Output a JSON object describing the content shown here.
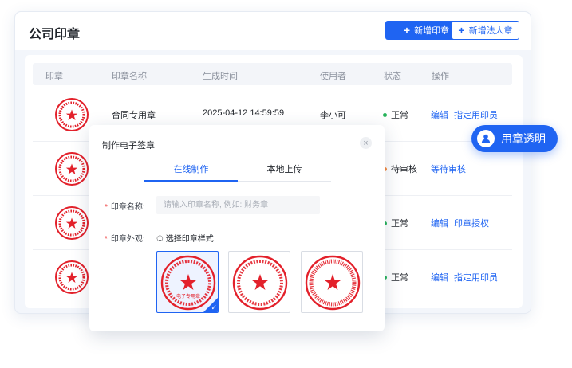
{
  "page": {
    "title": "公司印章"
  },
  "toolbar": {
    "new_seal_label": "新增印章",
    "new_legal_seal_label": "新增法人章"
  },
  "table": {
    "headers": [
      "印章",
      "印章名称",
      "生成时间",
      "使用者",
      "状态",
      "操作"
    ],
    "rows": [
      {
        "name": "合同专用章",
        "time": "2025-04-12 14:59:59",
        "user": "李小可",
        "status": "正常",
        "status_color": "#27b35a",
        "action1": "编辑",
        "action2": "指定用印员"
      },
      {
        "name": "",
        "time": "",
        "user": "",
        "status": "待审核",
        "status_color": "#f5873b",
        "action1": "等待审核",
        "action2": ""
      },
      {
        "name": "",
        "time": "",
        "user": "",
        "status": "正常",
        "status_color": "#27b35a",
        "action1": "编辑",
        "action2": "印章授权"
      },
      {
        "name": "",
        "time": "",
        "user": "",
        "status": "正常",
        "status_color": "#27b35a",
        "action1": "编辑",
        "action2": "指定用印员"
      }
    ]
  },
  "modal": {
    "title": "制作电子签章",
    "close_icon": "close-icon",
    "tabs": [
      "在线制作",
      "本地上传"
    ],
    "active_tab": "在线制作",
    "name_label": "印章名称:",
    "name_placeholder": "请输入印章名称, 例如: 财务章",
    "appearance_label": "印章外观:",
    "step_text": "① 选择印章样式",
    "styles": [
      {
        "bottom_text": "电子专用章",
        "selected": true
      },
      {
        "bottom_text": "",
        "selected": false
      },
      {
        "bottom_text": "",
        "selected": false
      }
    ]
  },
  "badge": {
    "label": "用章透明",
    "icon": "user-icon"
  },
  "colors": {
    "accent": "#1f64f2",
    "seal_red": "#e3212b",
    "ok": "#27b35a",
    "pending": "#f5873b"
  }
}
